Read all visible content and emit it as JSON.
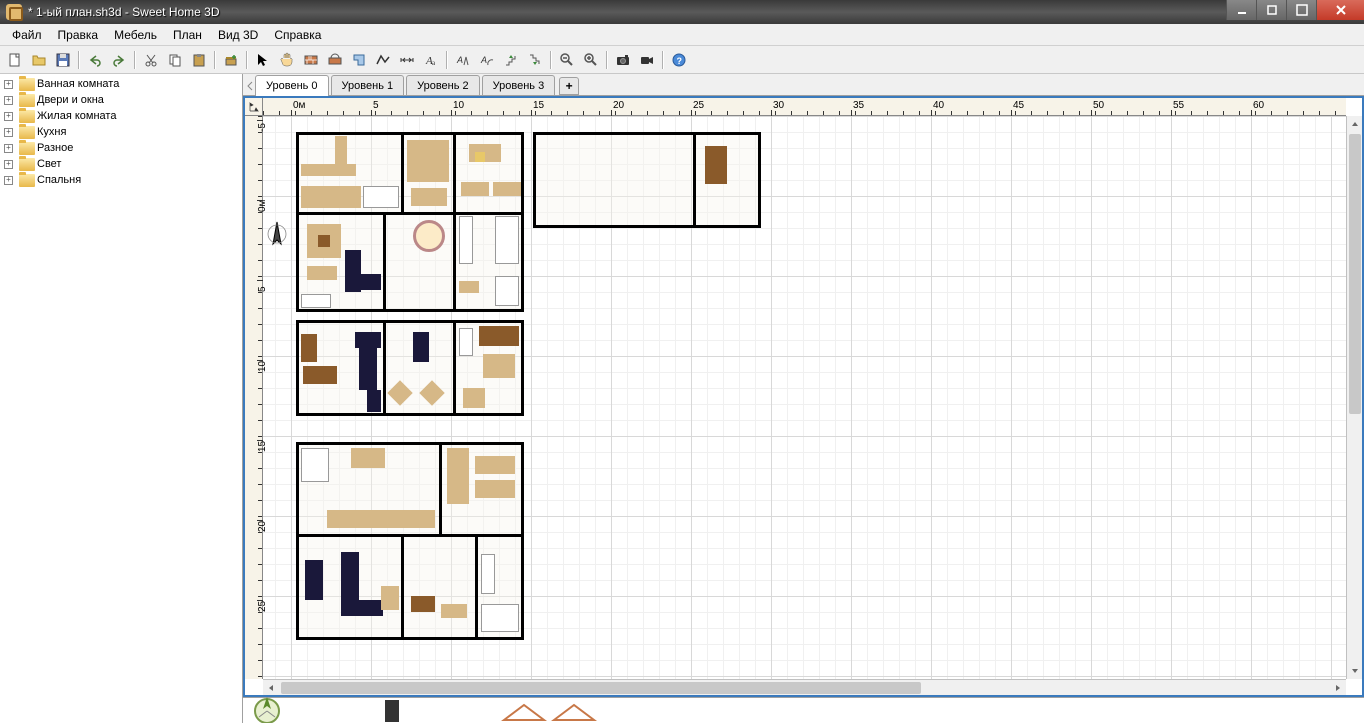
{
  "window": {
    "title": "* 1-ый план.sh3d - Sweet Home 3D"
  },
  "menu": {
    "items": [
      "Файл",
      "Правка",
      "Мебель",
      "План",
      "Вид 3D",
      "Справка"
    ]
  },
  "toolbar": {
    "icons": [
      "new-file-icon",
      "open-file-icon",
      "save-icon",
      "sep",
      "undo-icon",
      "redo-icon",
      "sep",
      "cut-icon",
      "copy-icon",
      "paste-icon",
      "sep",
      "add-furniture-icon",
      "sep",
      "select-tool-icon",
      "pan-tool-icon",
      "wall-tool-icon",
      "arc-wall-icon",
      "room-tool-icon",
      "polyline-tool-icon",
      "dimension-tool-icon",
      "text-tool-icon",
      "sep",
      "dimension-auto-icon",
      "dimension-arc-icon",
      "level-up-icon",
      "level-down-icon",
      "sep",
      "zoom-out-icon",
      "zoom-in-icon",
      "sep",
      "camera-photo-icon",
      "camera-video-icon",
      "sep",
      "help-icon"
    ]
  },
  "catalog": {
    "items": [
      "Ванная комната",
      "Двери и окна",
      "Жилая комната",
      "Кухня",
      "Разное",
      "Свет",
      "Спальня"
    ]
  },
  "tabs": {
    "items": [
      "Уровень 0",
      "Уровень 1",
      "Уровень 2",
      "Уровень 3"
    ],
    "active": 0,
    "add_label": "+"
  },
  "ruler": {
    "h_labels": [
      "0м",
      "5",
      "10",
      "15",
      "20",
      "25",
      "30",
      "35",
      "40",
      "45",
      "50",
      "55",
      "60"
    ],
    "h_positions": [
      28,
      108,
      188,
      268,
      348,
      428,
      508,
      588,
      668,
      748,
      828,
      908,
      988
    ],
    "v_labels": [
      "-5",
      "0м",
      "5",
      "10",
      "15",
      "20",
      "25"
    ],
    "v_positions": [
      4,
      84,
      164,
      244,
      324,
      404,
      484
    ]
  }
}
